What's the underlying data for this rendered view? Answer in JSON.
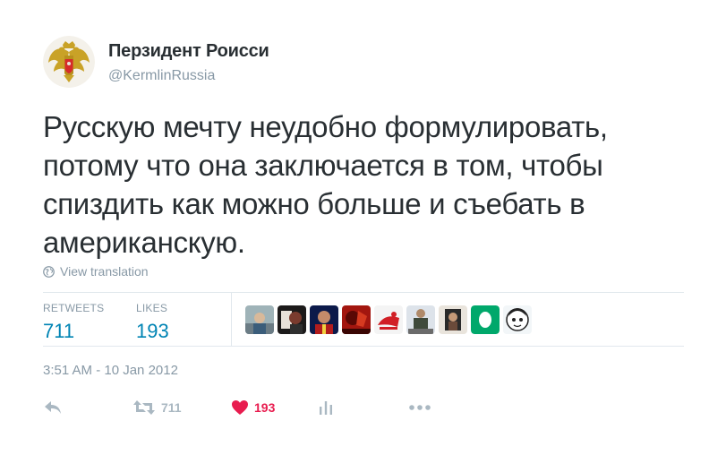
{
  "author": {
    "display_name": "Перзидент Роисси",
    "handle": "@KermlinRussia",
    "avatar_icon": "double-headed-eagle-coat-of-arms"
  },
  "tweet": {
    "lines": [
      "Русскую мечту неудобно формулировать,",
      "потому что она заключается в том, чтобы",
      "спиздить как можно больше и съебать в",
      "американскую."
    ],
    "translate_label": "View translation"
  },
  "stats": {
    "retweets_label": "RETWEETS",
    "retweets_value": "711",
    "likes_label": "LIKES",
    "likes_value": "193"
  },
  "timestamp": "3:51 AM - 10 Jan 2012",
  "actions": {
    "retweet_count": "711",
    "like_count": "193"
  },
  "colors": {
    "link_blue": "#0084b4",
    "muted_gray": "#8899a6",
    "like_red": "#e81c4f",
    "text": "#292f33"
  }
}
